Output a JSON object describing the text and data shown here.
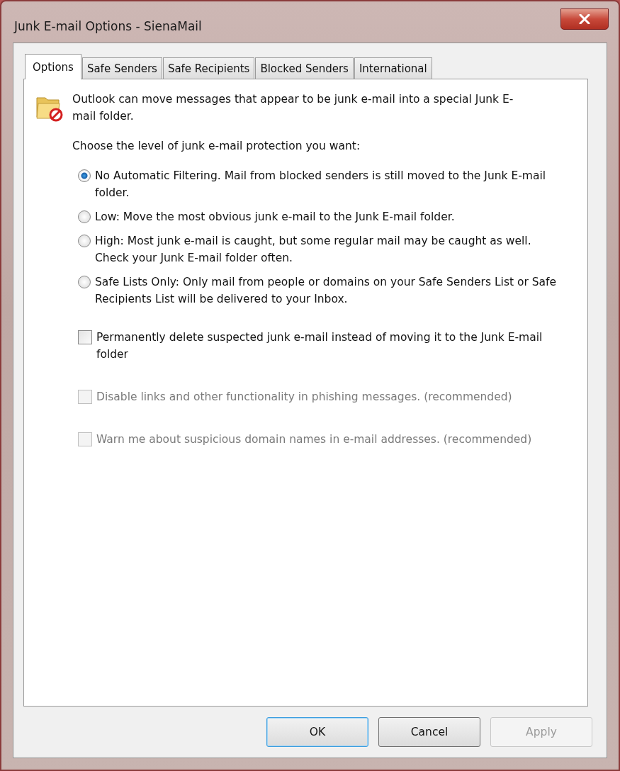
{
  "window": {
    "title": "Junk E-mail Options - SienaMail"
  },
  "tabs": [
    {
      "label": "Options",
      "selected": true
    },
    {
      "label": "Safe Senders",
      "selected": false
    },
    {
      "label": "Safe Recipients",
      "selected": false
    },
    {
      "label": "Blocked Senders",
      "selected": false
    },
    {
      "label": "International",
      "selected": false
    }
  ],
  "intro": "Outlook can move messages that appear to be junk e-mail into a special Junk E-mail folder.",
  "prompt": "Choose the level of junk e-mail protection you want:",
  "levels": [
    {
      "label": "No Automatic Filtering. Mail from blocked senders is still moved to the Junk E-mail folder.",
      "selected": true
    },
    {
      "label": "Low: Move the most obvious junk e-mail to the Junk E-mail folder.",
      "selected": false
    },
    {
      "label": "High: Most junk e-mail is caught, but some regular mail may be caught as well. Check your Junk E-mail folder often.",
      "selected": false
    },
    {
      "label": "Safe Lists Only: Only mail from people or domains on your Safe Senders List or Safe Recipients List will be delivered to your Inbox.",
      "selected": false
    }
  ],
  "options": [
    {
      "label": "Permanently delete suspected junk e-mail instead of moving it to the Junk E-mail folder",
      "checked": false,
      "disabled": false
    },
    {
      "label": "Disable links and other functionality in phishing messages. (recommended)",
      "checked": false,
      "disabled": true
    },
    {
      "label": "Warn me about suspicious domain names in e-mail addresses. (recommended)",
      "checked": false,
      "disabled": true
    }
  ],
  "buttons": [
    {
      "label": "OK",
      "default": true,
      "disabled": false
    },
    {
      "label": "Cancel",
      "default": false,
      "disabled": false
    },
    {
      "label": "Apply",
      "default": false,
      "disabled": true
    }
  ]
}
